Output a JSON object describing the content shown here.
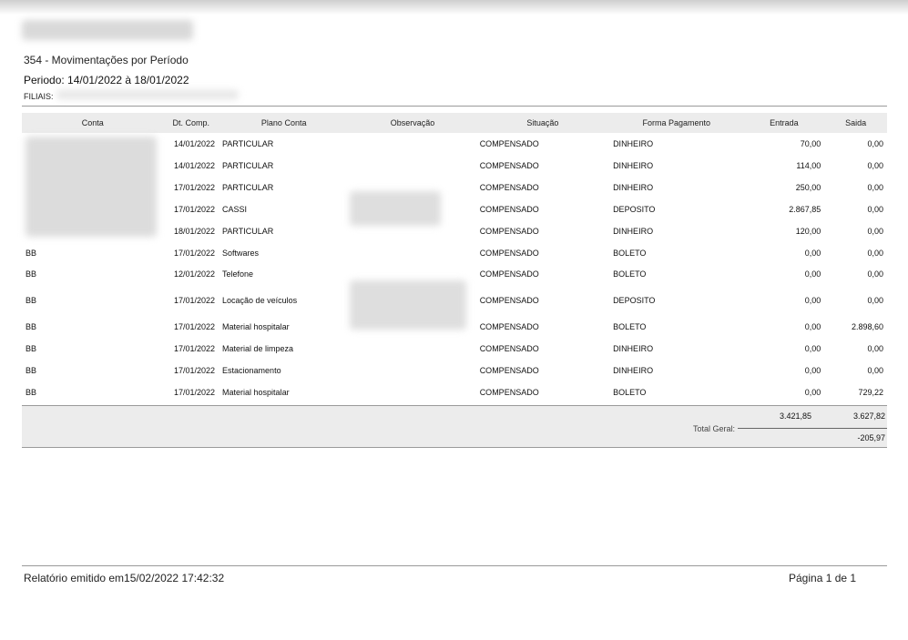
{
  "report": {
    "title": "354 - Movimentações por Período",
    "period_label": "Periodo: 14/01/2022 à 18/01/2022",
    "filiais_label": "FILIAIS:"
  },
  "table": {
    "headers": [
      "Conta",
      "Dt. Comp.",
      "Plano Conta",
      "Observação",
      "Situação",
      "Forma Pagamento",
      "Entrada",
      "Saida"
    ],
    "rows": [
      {
        "conta": "",
        "date": "14/01/2022",
        "plano": "PARTICULAR",
        "obs": "",
        "situacao": "COMPENSADO",
        "forma": "DINHEIRO",
        "entrada": "70,00",
        "saida": "0,00"
      },
      {
        "conta": "",
        "date": "14/01/2022",
        "plano": "PARTICULAR",
        "obs": "",
        "situacao": "COMPENSADO",
        "forma": "DINHEIRO",
        "entrada": "114,00",
        "saida": "0,00"
      },
      {
        "conta": "",
        "date": "17/01/2022",
        "plano": "PARTICULAR",
        "obs": "",
        "situacao": "COMPENSADO",
        "forma": "DINHEIRO",
        "entrada": "250,00",
        "saida": "0,00"
      },
      {
        "conta": "",
        "date": "17/01/2022",
        "plano": "CASSI",
        "obs": "",
        "situacao": "COMPENSADO",
        "forma": "DEPOSITO",
        "entrada": "2.867,85",
        "saida": "0,00"
      },
      {
        "conta": "",
        "date": "18/01/2022",
        "plano": "PARTICULAR",
        "obs": "",
        "situacao": "COMPENSADO",
        "forma": "DINHEIRO",
        "entrada": "120,00",
        "saida": "0,00"
      },
      {
        "conta": "BB",
        "date": "17/01/2022",
        "plano": "Softwares",
        "obs": "",
        "situacao": "COMPENSADO",
        "forma": "BOLETO",
        "entrada": "0,00",
        "saida": "0,00"
      },
      {
        "conta": "BB",
        "date": "12/01/2022",
        "plano": "Telefone",
        "obs": "",
        "situacao": "COMPENSADO",
        "forma": "BOLETO",
        "entrada": "0,00",
        "saida": "0,00"
      },
      {
        "conta": "BB",
        "date": "17/01/2022",
        "plano": "Locação de veículos",
        "obs": "",
        "situacao": "COMPENSADO",
        "forma": "DEPOSITO",
        "entrada": "0,00",
        "saida": "0,00"
      },
      {
        "conta": "BB",
        "date": "17/01/2022",
        "plano": "Material hospitalar",
        "obs": "",
        "situacao": "COMPENSADO",
        "forma": "BOLETO",
        "entrada": "0,00",
        "saida": "2.898,60"
      },
      {
        "conta": "BB",
        "date": "17/01/2022",
        "plano": "Material de limpeza",
        "obs": "",
        "situacao": "COMPENSADO",
        "forma": "DINHEIRO",
        "entrada": "0,00",
        "saida": "0,00"
      },
      {
        "conta": "BB",
        "date": "17/01/2022",
        "plano": "Estacionamento",
        "obs": "",
        "situacao": "COMPENSADO",
        "forma": "DINHEIRO",
        "entrada": "0,00",
        "saida": "0,00"
      },
      {
        "conta": "BB",
        "date": "17/01/2022",
        "plano": "Material hospitalar",
        "obs": "",
        "situacao": "COMPENSADO",
        "forma": "BOLETO",
        "entrada": "0,00",
        "saida": "729,22"
      }
    ]
  },
  "totals": {
    "entrada": "3.421,85",
    "saida": "3.627,82",
    "label": "Total Geral:",
    "net": "-205,97"
  },
  "footer": {
    "emitted": "Relatório emitido em15/02/2022 17:42:32",
    "page": "Página 1 de 1"
  }
}
